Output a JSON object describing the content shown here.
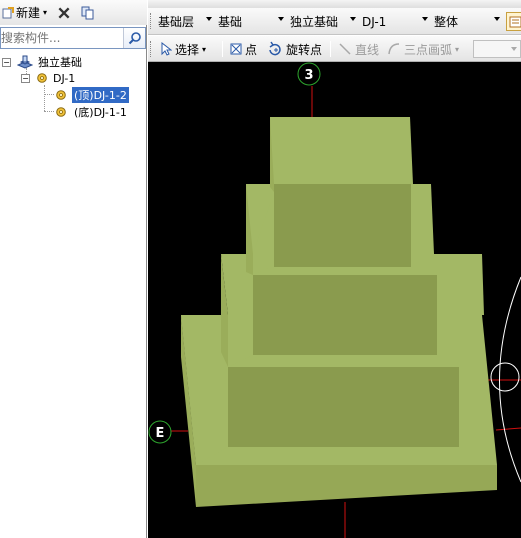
{
  "left_toolbar": {
    "new_label": "新建"
  },
  "search": {
    "placeholder": "搜索构件..."
  },
  "tree": {
    "root_label": "独立基础",
    "group_label": "DJ-1",
    "children": [
      "(顶)DJ-1-2",
      "(底)DJ-1-1"
    ],
    "selected_index": 0
  },
  "selector_bar": {
    "floor": "基础层",
    "category": "基础",
    "type": "独立基础",
    "component": "DJ-1",
    "scope": "整体"
  },
  "draw_toolbar": {
    "select_label": "选择",
    "point_label": "点",
    "rotate_point_label": "旋转点",
    "line_label": "直线",
    "arc_label": "三点画弧"
  },
  "viewport": {
    "axis_top_label": "3",
    "axis_left_label": "E",
    "colors": {
      "background": "#000000",
      "axis_line": "#d01010",
      "front_face": "#8a9b4e",
      "top_face": "#a3b865",
      "side_face": "#9aad5a",
      "label_circle": "#2ea52e"
    }
  }
}
